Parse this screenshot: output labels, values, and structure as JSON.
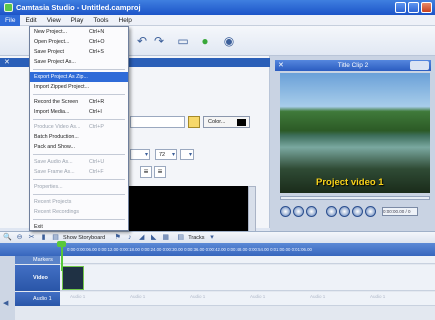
{
  "window": {
    "title": "Camtasia Studio - Untitled.camproj"
  },
  "menubar": [
    "File",
    "Edit",
    "View",
    "Play",
    "Tools",
    "Help"
  ],
  "file_menu": {
    "items": [
      {
        "label": "New Project...",
        "shortcut": "Ctrl+N",
        "disabled": false
      },
      {
        "label": "Open Project...",
        "shortcut": "Ctrl+O",
        "disabled": false
      },
      {
        "label": "Save Project",
        "shortcut": "Ctrl+S",
        "disabled": false
      },
      {
        "label": "Save Project As...",
        "shortcut": "",
        "disabled": false
      },
      {
        "separator": true
      },
      {
        "label": "Export Project As Zip...",
        "shortcut": "",
        "disabled": false,
        "highlighted": true
      },
      {
        "label": "Import Zipped Project...",
        "shortcut": "",
        "disabled": false
      },
      {
        "separator": true
      },
      {
        "label": "Record the Screen",
        "shortcut": "Ctrl+R",
        "disabled": false
      },
      {
        "label": "Import Media...",
        "shortcut": "Ctrl+I",
        "disabled": false
      },
      {
        "separator": true
      },
      {
        "label": "Produce Video As...",
        "shortcut": "Ctrl+P",
        "disabled": true
      },
      {
        "label": "Batch Production...",
        "shortcut": "",
        "disabled": false
      },
      {
        "label": "Pack and Show...",
        "shortcut": "",
        "disabled": false
      },
      {
        "separator": true
      },
      {
        "label": "Save Audio As...",
        "shortcut": "Ctrl+U",
        "disabled": true
      },
      {
        "label": "Save Frame As...",
        "shortcut": "Ctrl+F",
        "disabled": true
      },
      {
        "separator": true
      },
      {
        "label": "Properties...",
        "shortcut": "",
        "disabled": true
      },
      {
        "separator": true
      },
      {
        "label": "Recent Projects",
        "shortcut": "",
        "disabled": true
      },
      {
        "label": "Recent Recordings",
        "shortcut": "",
        "disabled": true
      },
      {
        "separator": true
      },
      {
        "label": "Exit",
        "shortcut": "",
        "disabled": false
      }
    ]
  },
  "editor": {
    "color_button": "Color...",
    "font_size": "72"
  },
  "preview": {
    "title": "Title Clip 2",
    "caption": "Project video 1",
    "time": "0:00:00.00 / 0"
  },
  "timeline_toolbar": {
    "storyboard_label": "Show Storyboard",
    "tracks_label": "Tracks"
  },
  "ruler": "0:00   0:00:06.00   0:00:12.00   0:00:18.00   0:00:24.00   0:00:30.00   0:00:36.00   0:00:42.00   0:00:48.00   0:00:54.00   0:01:00.00   0:01:06.00",
  "tracks": {
    "markers": "Markers",
    "video": "Video",
    "audio": "Audio 1",
    "lane_filler": "Audio 1"
  },
  "colors": {
    "titlebar": "#1c54c8",
    "accent": "#2f6bd8",
    "caption": "#f8d21a",
    "playhead": "#58c83a"
  }
}
